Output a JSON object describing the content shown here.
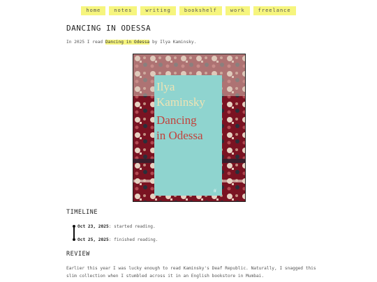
{
  "nav": [
    "home",
    "notes",
    "writing",
    "bookshelf",
    "work",
    "freelance"
  ],
  "page_title": "DANCING IN ODESSA",
  "intro": {
    "before": "In 2025 I read ",
    "book": "Dancing in Odessa",
    "after": " by Ilya Kaminsky."
  },
  "cover": {
    "author_line1": "Ilya",
    "author_line2": "Kaminsky",
    "title_line1": "Dancing",
    "title_line2": "in Odessa",
    "publisher_mark": "ff"
  },
  "timeline": {
    "heading": "TIMELINE",
    "events": [
      {
        "date": "Oct 23, 2025",
        "text": ": started reading."
      },
      {
        "date": "Oct 25, 2025",
        "text": ": finished reading."
      }
    ]
  },
  "review": {
    "heading": "REVIEW",
    "text": "Earlier this year I was lucky enough to read Kaminsky's Deaf Republic. Naturally, I snagged this slim collection when I stumbled across it in an English bookstore in Mumbai."
  },
  "colors": {
    "highlight": "#f6f57e",
    "book_cover": "#8fd4cf",
    "author_text": "#efe3b4",
    "title_text": "#c2423c",
    "rug": "#7a1322"
  }
}
